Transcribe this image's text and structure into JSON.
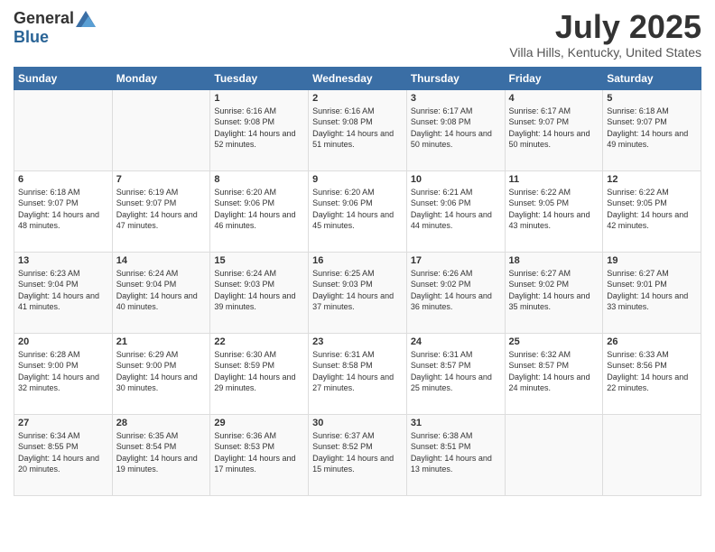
{
  "header": {
    "logo_general": "General",
    "logo_blue": "Blue",
    "month_title": "July 2025",
    "location": "Villa Hills, Kentucky, United States"
  },
  "weekdays": [
    "Sunday",
    "Monday",
    "Tuesday",
    "Wednesday",
    "Thursday",
    "Friday",
    "Saturday"
  ],
  "weeks": [
    [
      {
        "day": "",
        "sunrise": "",
        "sunset": "",
        "daylight": ""
      },
      {
        "day": "",
        "sunrise": "",
        "sunset": "",
        "daylight": ""
      },
      {
        "day": "1",
        "sunrise": "Sunrise: 6:16 AM",
        "sunset": "Sunset: 9:08 PM",
        "daylight": "Daylight: 14 hours and 52 minutes."
      },
      {
        "day": "2",
        "sunrise": "Sunrise: 6:16 AM",
        "sunset": "Sunset: 9:08 PM",
        "daylight": "Daylight: 14 hours and 51 minutes."
      },
      {
        "day": "3",
        "sunrise": "Sunrise: 6:17 AM",
        "sunset": "Sunset: 9:08 PM",
        "daylight": "Daylight: 14 hours and 50 minutes."
      },
      {
        "day": "4",
        "sunrise": "Sunrise: 6:17 AM",
        "sunset": "Sunset: 9:07 PM",
        "daylight": "Daylight: 14 hours and 50 minutes."
      },
      {
        "day": "5",
        "sunrise": "Sunrise: 6:18 AM",
        "sunset": "Sunset: 9:07 PM",
        "daylight": "Daylight: 14 hours and 49 minutes."
      }
    ],
    [
      {
        "day": "6",
        "sunrise": "Sunrise: 6:18 AM",
        "sunset": "Sunset: 9:07 PM",
        "daylight": "Daylight: 14 hours and 48 minutes."
      },
      {
        "day": "7",
        "sunrise": "Sunrise: 6:19 AM",
        "sunset": "Sunset: 9:07 PM",
        "daylight": "Daylight: 14 hours and 47 minutes."
      },
      {
        "day": "8",
        "sunrise": "Sunrise: 6:20 AM",
        "sunset": "Sunset: 9:06 PM",
        "daylight": "Daylight: 14 hours and 46 minutes."
      },
      {
        "day": "9",
        "sunrise": "Sunrise: 6:20 AM",
        "sunset": "Sunset: 9:06 PM",
        "daylight": "Daylight: 14 hours and 45 minutes."
      },
      {
        "day": "10",
        "sunrise": "Sunrise: 6:21 AM",
        "sunset": "Sunset: 9:06 PM",
        "daylight": "Daylight: 14 hours and 44 minutes."
      },
      {
        "day": "11",
        "sunrise": "Sunrise: 6:22 AM",
        "sunset": "Sunset: 9:05 PM",
        "daylight": "Daylight: 14 hours and 43 minutes."
      },
      {
        "day": "12",
        "sunrise": "Sunrise: 6:22 AM",
        "sunset": "Sunset: 9:05 PM",
        "daylight": "Daylight: 14 hours and 42 minutes."
      }
    ],
    [
      {
        "day": "13",
        "sunrise": "Sunrise: 6:23 AM",
        "sunset": "Sunset: 9:04 PM",
        "daylight": "Daylight: 14 hours and 41 minutes."
      },
      {
        "day": "14",
        "sunrise": "Sunrise: 6:24 AM",
        "sunset": "Sunset: 9:04 PM",
        "daylight": "Daylight: 14 hours and 40 minutes."
      },
      {
        "day": "15",
        "sunrise": "Sunrise: 6:24 AM",
        "sunset": "Sunset: 9:03 PM",
        "daylight": "Daylight: 14 hours and 39 minutes."
      },
      {
        "day": "16",
        "sunrise": "Sunrise: 6:25 AM",
        "sunset": "Sunset: 9:03 PM",
        "daylight": "Daylight: 14 hours and 37 minutes."
      },
      {
        "day": "17",
        "sunrise": "Sunrise: 6:26 AM",
        "sunset": "Sunset: 9:02 PM",
        "daylight": "Daylight: 14 hours and 36 minutes."
      },
      {
        "day": "18",
        "sunrise": "Sunrise: 6:27 AM",
        "sunset": "Sunset: 9:02 PM",
        "daylight": "Daylight: 14 hours and 35 minutes."
      },
      {
        "day": "19",
        "sunrise": "Sunrise: 6:27 AM",
        "sunset": "Sunset: 9:01 PM",
        "daylight": "Daylight: 14 hours and 33 minutes."
      }
    ],
    [
      {
        "day": "20",
        "sunrise": "Sunrise: 6:28 AM",
        "sunset": "Sunset: 9:00 PM",
        "daylight": "Daylight: 14 hours and 32 minutes."
      },
      {
        "day": "21",
        "sunrise": "Sunrise: 6:29 AM",
        "sunset": "Sunset: 9:00 PM",
        "daylight": "Daylight: 14 hours and 30 minutes."
      },
      {
        "day": "22",
        "sunrise": "Sunrise: 6:30 AM",
        "sunset": "Sunset: 8:59 PM",
        "daylight": "Daylight: 14 hours and 29 minutes."
      },
      {
        "day": "23",
        "sunrise": "Sunrise: 6:31 AM",
        "sunset": "Sunset: 8:58 PM",
        "daylight": "Daylight: 14 hours and 27 minutes."
      },
      {
        "day": "24",
        "sunrise": "Sunrise: 6:31 AM",
        "sunset": "Sunset: 8:57 PM",
        "daylight": "Daylight: 14 hours and 25 minutes."
      },
      {
        "day": "25",
        "sunrise": "Sunrise: 6:32 AM",
        "sunset": "Sunset: 8:57 PM",
        "daylight": "Daylight: 14 hours and 24 minutes."
      },
      {
        "day": "26",
        "sunrise": "Sunrise: 6:33 AM",
        "sunset": "Sunset: 8:56 PM",
        "daylight": "Daylight: 14 hours and 22 minutes."
      }
    ],
    [
      {
        "day": "27",
        "sunrise": "Sunrise: 6:34 AM",
        "sunset": "Sunset: 8:55 PM",
        "daylight": "Daylight: 14 hours and 20 minutes."
      },
      {
        "day": "28",
        "sunrise": "Sunrise: 6:35 AM",
        "sunset": "Sunset: 8:54 PM",
        "daylight": "Daylight: 14 hours and 19 minutes."
      },
      {
        "day": "29",
        "sunrise": "Sunrise: 6:36 AM",
        "sunset": "Sunset: 8:53 PM",
        "daylight": "Daylight: 14 hours and 17 minutes."
      },
      {
        "day": "30",
        "sunrise": "Sunrise: 6:37 AM",
        "sunset": "Sunset: 8:52 PM",
        "daylight": "Daylight: 14 hours and 15 minutes."
      },
      {
        "day": "31",
        "sunrise": "Sunrise: 6:38 AM",
        "sunset": "Sunset: 8:51 PM",
        "daylight": "Daylight: 14 hours and 13 minutes."
      },
      {
        "day": "",
        "sunrise": "",
        "sunset": "",
        "daylight": ""
      },
      {
        "day": "",
        "sunrise": "",
        "sunset": "",
        "daylight": ""
      }
    ]
  ]
}
